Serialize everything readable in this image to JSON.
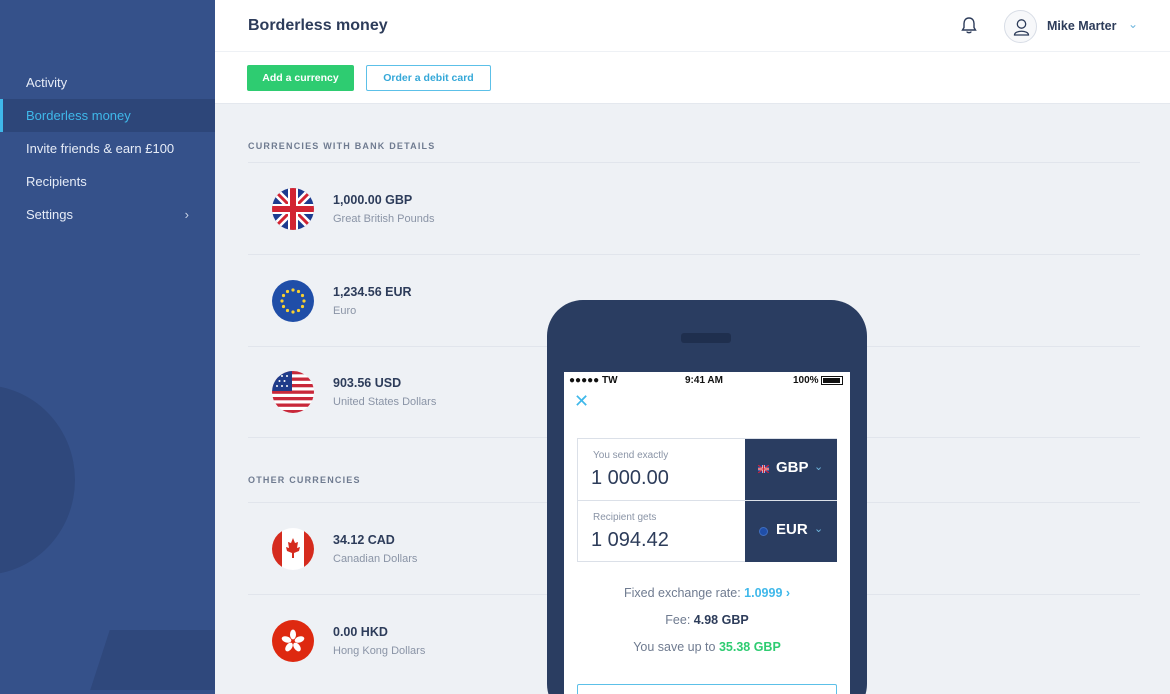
{
  "sidebar": {
    "items": [
      {
        "label": "Activity"
      },
      {
        "label": "Borderless money",
        "active": true
      },
      {
        "label": "Invite friends & earn £100"
      },
      {
        "label": "Recipients"
      },
      {
        "label": "Settings",
        "chevron": "›"
      }
    ]
  },
  "header": {
    "title": "Borderless money",
    "add_currency": "Add a currency",
    "order_card": "Order a debit card",
    "notification_icon": "bell-icon",
    "user_name": "Mike Marter",
    "user_chevron": "⌄"
  },
  "sections": {
    "with_bank_details": "CURRENCIES WITH BANK DETAILS",
    "other": "OTHER CURRENCIES"
  },
  "currencies_bank": [
    {
      "amount": "1,000.00 GBP",
      "name": "Great British Pounds",
      "flag": "uk-flag-icon"
    },
    {
      "amount": "1,234.56 EUR",
      "name": "Euro",
      "flag": "eu-flag-icon"
    },
    {
      "amount": "903.56 USD",
      "name": "United States Dollars",
      "flag": "us-flag-icon"
    }
  ],
  "currencies_other": [
    {
      "amount": "34.12 CAD",
      "name": "Canadian Dollars",
      "flag": "canada-flag-icon"
    },
    {
      "amount": "0.00 HKD",
      "name": "Hong Kong Dollars",
      "flag": "hk-flag-icon"
    }
  ],
  "phone": {
    "status_left": "●●●●● TW",
    "status_time": "9:41 AM",
    "status_battery": "100%",
    "close": "✕",
    "send_label": "You send exactly",
    "send_value": "1 000.00",
    "send_currency": "GBP",
    "receive_label": "Recipient gets",
    "receive_value": "1 094.42",
    "receive_currency": "EUR",
    "rate_prefix": "Fixed exchange rate: ",
    "rate_value": "1.0999 ›",
    "fee_prefix": "Fee: ",
    "fee_value": "4.98 GBP",
    "save_prefix": "You save up to ",
    "save_value": "35.38 GBP"
  },
  "colors": {
    "sidebar_bg": "#35518a",
    "accent_blue": "#3fb8ea",
    "accent_green": "#2ecc71",
    "navy": "#2a3d61"
  }
}
